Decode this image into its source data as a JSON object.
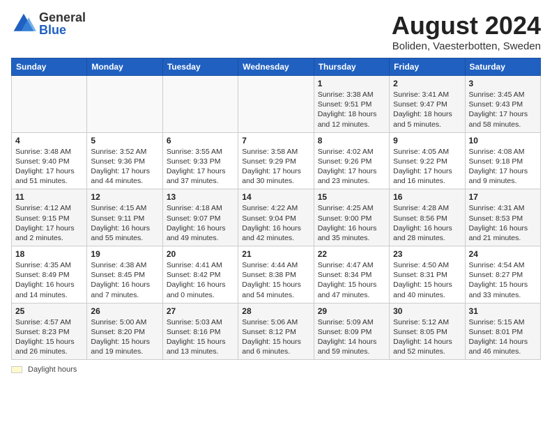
{
  "header": {
    "title": "August 2024",
    "subtitle": "Boliden, Vaesterbotten, Sweden",
    "logo_general": "General",
    "logo_blue": "Blue"
  },
  "days_of_week": [
    "Sunday",
    "Monday",
    "Tuesday",
    "Wednesday",
    "Thursday",
    "Friday",
    "Saturday"
  ],
  "weeks": [
    [
      {
        "day": "",
        "info": ""
      },
      {
        "day": "",
        "info": ""
      },
      {
        "day": "",
        "info": ""
      },
      {
        "day": "",
        "info": ""
      },
      {
        "day": "1",
        "info": "Sunrise: 3:38 AM\nSunset: 9:51 PM\nDaylight: 18 hours\nand 12 minutes."
      },
      {
        "day": "2",
        "info": "Sunrise: 3:41 AM\nSunset: 9:47 PM\nDaylight: 18 hours\nand 5 minutes."
      },
      {
        "day": "3",
        "info": "Sunrise: 3:45 AM\nSunset: 9:43 PM\nDaylight: 17 hours\nand 58 minutes."
      }
    ],
    [
      {
        "day": "4",
        "info": "Sunrise: 3:48 AM\nSunset: 9:40 PM\nDaylight: 17 hours\nand 51 minutes."
      },
      {
        "day": "5",
        "info": "Sunrise: 3:52 AM\nSunset: 9:36 PM\nDaylight: 17 hours\nand 44 minutes."
      },
      {
        "day": "6",
        "info": "Sunrise: 3:55 AM\nSunset: 9:33 PM\nDaylight: 17 hours\nand 37 minutes."
      },
      {
        "day": "7",
        "info": "Sunrise: 3:58 AM\nSunset: 9:29 PM\nDaylight: 17 hours\nand 30 minutes."
      },
      {
        "day": "8",
        "info": "Sunrise: 4:02 AM\nSunset: 9:26 PM\nDaylight: 17 hours\nand 23 minutes."
      },
      {
        "day": "9",
        "info": "Sunrise: 4:05 AM\nSunset: 9:22 PM\nDaylight: 17 hours\nand 16 minutes."
      },
      {
        "day": "10",
        "info": "Sunrise: 4:08 AM\nSunset: 9:18 PM\nDaylight: 17 hours\nand 9 minutes."
      }
    ],
    [
      {
        "day": "11",
        "info": "Sunrise: 4:12 AM\nSunset: 9:15 PM\nDaylight: 17 hours\nand 2 minutes."
      },
      {
        "day": "12",
        "info": "Sunrise: 4:15 AM\nSunset: 9:11 PM\nDaylight: 16 hours\nand 55 minutes."
      },
      {
        "day": "13",
        "info": "Sunrise: 4:18 AM\nSunset: 9:07 PM\nDaylight: 16 hours\nand 49 minutes."
      },
      {
        "day": "14",
        "info": "Sunrise: 4:22 AM\nSunset: 9:04 PM\nDaylight: 16 hours\nand 42 minutes."
      },
      {
        "day": "15",
        "info": "Sunrise: 4:25 AM\nSunset: 9:00 PM\nDaylight: 16 hours\nand 35 minutes."
      },
      {
        "day": "16",
        "info": "Sunrise: 4:28 AM\nSunset: 8:56 PM\nDaylight: 16 hours\nand 28 minutes."
      },
      {
        "day": "17",
        "info": "Sunrise: 4:31 AM\nSunset: 8:53 PM\nDaylight: 16 hours\nand 21 minutes."
      }
    ],
    [
      {
        "day": "18",
        "info": "Sunrise: 4:35 AM\nSunset: 8:49 PM\nDaylight: 16 hours\nand 14 minutes."
      },
      {
        "day": "19",
        "info": "Sunrise: 4:38 AM\nSunset: 8:45 PM\nDaylight: 16 hours\nand 7 minutes."
      },
      {
        "day": "20",
        "info": "Sunrise: 4:41 AM\nSunset: 8:42 PM\nDaylight: 16 hours\nand 0 minutes."
      },
      {
        "day": "21",
        "info": "Sunrise: 4:44 AM\nSunset: 8:38 PM\nDaylight: 15 hours\nand 54 minutes."
      },
      {
        "day": "22",
        "info": "Sunrise: 4:47 AM\nSunset: 8:34 PM\nDaylight: 15 hours\nand 47 minutes."
      },
      {
        "day": "23",
        "info": "Sunrise: 4:50 AM\nSunset: 8:31 PM\nDaylight: 15 hours\nand 40 minutes."
      },
      {
        "day": "24",
        "info": "Sunrise: 4:54 AM\nSunset: 8:27 PM\nDaylight: 15 hours\nand 33 minutes."
      }
    ],
    [
      {
        "day": "25",
        "info": "Sunrise: 4:57 AM\nSunset: 8:23 PM\nDaylight: 15 hours\nand 26 minutes."
      },
      {
        "day": "26",
        "info": "Sunrise: 5:00 AM\nSunset: 8:20 PM\nDaylight: 15 hours\nand 19 minutes."
      },
      {
        "day": "27",
        "info": "Sunrise: 5:03 AM\nSunset: 8:16 PM\nDaylight: 15 hours\nand 13 minutes."
      },
      {
        "day": "28",
        "info": "Sunrise: 5:06 AM\nSunset: 8:12 PM\nDaylight: 15 hours\nand 6 minutes."
      },
      {
        "day": "29",
        "info": "Sunrise: 5:09 AM\nSunset: 8:09 PM\nDaylight: 14 hours\nand 59 minutes."
      },
      {
        "day": "30",
        "info": "Sunrise: 5:12 AM\nSunset: 8:05 PM\nDaylight: 14 hours\nand 52 minutes."
      },
      {
        "day": "31",
        "info": "Sunrise: 5:15 AM\nSunset: 8:01 PM\nDaylight: 14 hours\nand 46 minutes."
      }
    ]
  ],
  "footer": {
    "daylight_label": "Daylight hours"
  }
}
